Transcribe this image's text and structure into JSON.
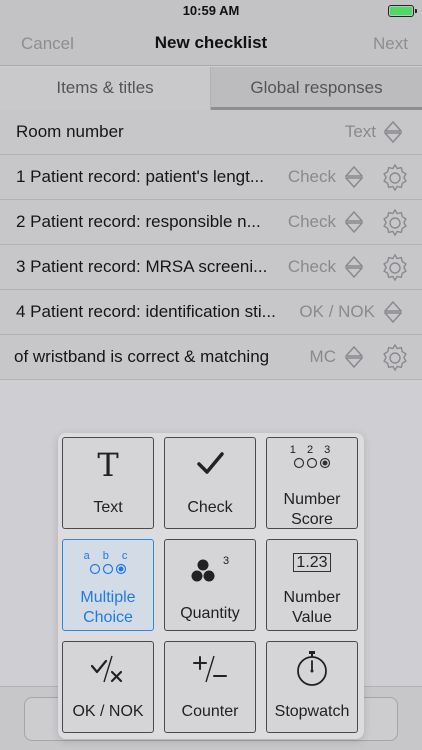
{
  "status": {
    "time": "10:59 AM"
  },
  "nav": {
    "cancel": "Cancel",
    "title": "New checklist",
    "next": "Next"
  },
  "tabs": [
    {
      "label": "Items & titles"
    },
    {
      "label": "Global responses"
    }
  ],
  "rows": [
    {
      "label": "Room number",
      "type": "Text",
      "gear": false
    },
    {
      "label": "1 Patient record: patient's lengt...",
      "type": "Check",
      "gear": true
    },
    {
      "label": "2 Patient record: responsible n...",
      "type": "Check",
      "gear": true
    },
    {
      "label": "3 Patient record: MRSA screeni...",
      "type": "Check",
      "gear": true
    },
    {
      "label": "4 Patient record: identification sti...",
      "type": "OK / NOK",
      "gear": true
    },
    {
      "label": "of wristband is correct & matching",
      "type": "MC",
      "gear": true
    }
  ],
  "picker": {
    "text": "Text",
    "check": "Check",
    "number_score_1": "Number",
    "number_score_2": "Score",
    "number_score_digits": "1 2 3",
    "multiple_choice_1": "Multiple",
    "multiple_choice_2": "Choice",
    "multiple_choice_letters": "a b c",
    "quantity": "Quantity",
    "quantity_sup": "3",
    "number_value_1": "Number",
    "number_value_2": "Value",
    "number_value_sample": "1.23",
    "ok_nok": "OK / NOK",
    "counter": "Counter",
    "stopwatch": "Stopwatch"
  },
  "colors": {
    "accent": "#1f7be3",
    "battery": "#4cd964"
  }
}
